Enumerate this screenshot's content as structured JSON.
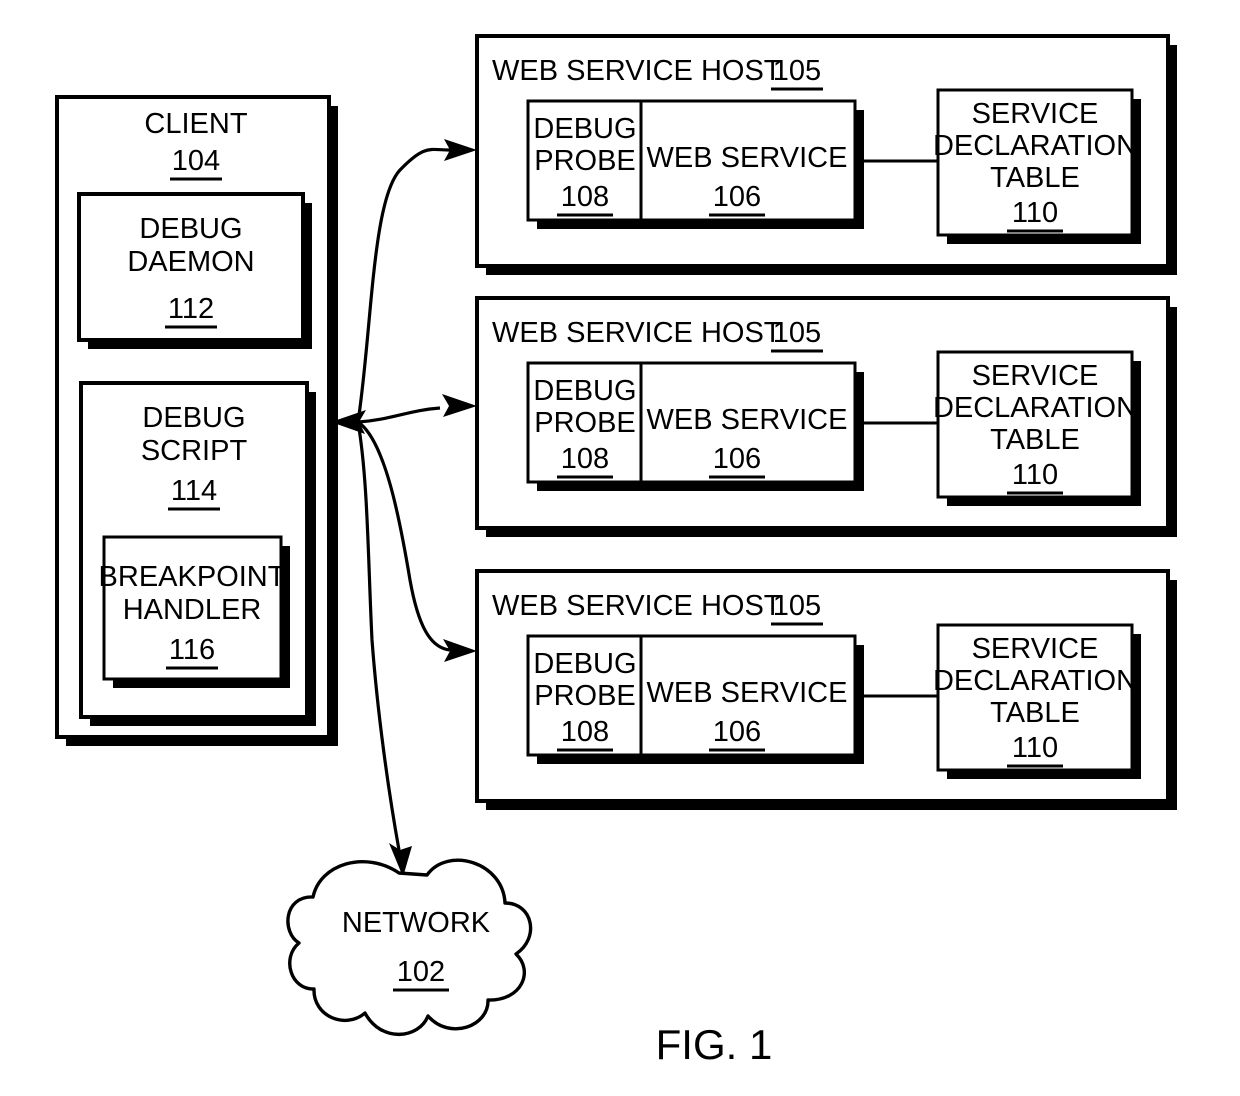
{
  "figure": {
    "label": "FIG. 1",
    "title": "Web service debugging architecture block diagram"
  },
  "client": {
    "label": "CLIENT",
    "ref": "104",
    "children": [
      {
        "name": "debug-daemon",
        "line1": "DEBUG",
        "line2": "DAEMON",
        "ref": "112"
      },
      {
        "name": "debug-script",
        "line1": "DEBUG",
        "line2": "SCRIPT",
        "ref": "114",
        "children": [
          {
            "name": "breakpoint-handler",
            "line1": "BREAKPOINT",
            "line2": "HANDLER",
            "ref": "116"
          }
        ]
      }
    ]
  },
  "hosts": [
    {
      "title": "WEB SERVICE HOST",
      "ref": "105",
      "debug_probe": {
        "line1": "DEBUG",
        "line2": "PROBE",
        "ref": "108"
      },
      "web_service": {
        "line1": "WEB SERVICE",
        "ref": "106"
      },
      "declaration_table": {
        "line1": "SERVICE",
        "line2": "DECLARATION",
        "line3": "TABLE",
        "ref": "110"
      }
    },
    {
      "title": "WEB SERVICE HOST",
      "ref": "105",
      "debug_probe": {
        "line1": "DEBUG",
        "line2": "PROBE",
        "ref": "108"
      },
      "web_service": {
        "line1": "WEB SERVICE",
        "ref": "106"
      },
      "declaration_table": {
        "line1": "SERVICE",
        "line2": "DECLARATION",
        "line3": "TABLE",
        "ref": "110"
      }
    },
    {
      "title": "WEB SERVICE HOST",
      "ref": "105",
      "debug_probe": {
        "line1": "DEBUG",
        "line2": "PROBE",
        "ref": "108"
      },
      "web_service": {
        "line1": "WEB SERVICE",
        "ref": "106"
      },
      "declaration_table": {
        "line1": "SERVICE",
        "line2": "DECLARATION",
        "line3": "TABLE",
        "ref": "110"
      }
    }
  ],
  "network": {
    "label": "NETWORK",
    "ref": "102"
  },
  "colors": {
    "ink": "#000000",
    "paper": "#ffffff"
  }
}
